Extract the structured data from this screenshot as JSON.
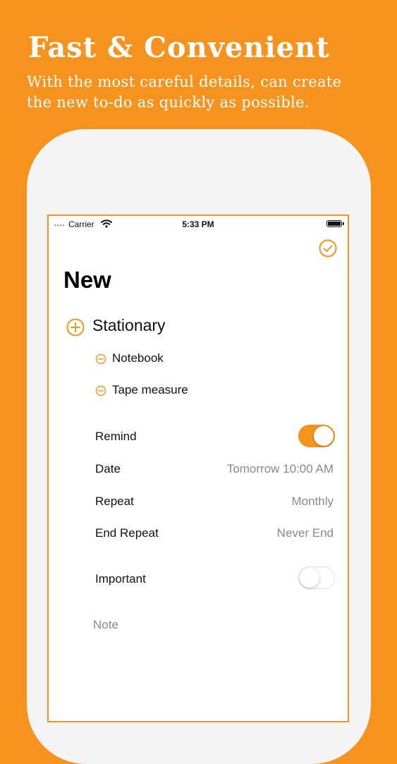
{
  "promo": {
    "headline": "Fast & Convenient",
    "subtitle_line1": "With the most careful details, can create",
    "subtitle_line2": "the new to-do as quickly as possible."
  },
  "status_bar": {
    "signal": "••••",
    "carrier": "Carrier",
    "time": "5:33 PM",
    "battery": "battery-full-icon",
    "wifi": "wifi-icon"
  },
  "header": {
    "title": "New",
    "done_icon": "checkmark-circle-icon"
  },
  "group": {
    "name": "Stationary",
    "add_icon": "plus-circle-icon",
    "items": [
      {
        "label": "Notebook",
        "icon": "minus-circle-icon"
      },
      {
        "label": "Tape measure",
        "icon": "minus-circle-icon"
      }
    ]
  },
  "settings": {
    "remind": {
      "label": "Remind",
      "enabled": true
    },
    "date": {
      "label": "Date",
      "value": "Tomorrow 10:00 AM"
    },
    "repeat": {
      "label": "Repeat",
      "value": "Monthly"
    },
    "end_repeat": {
      "label": "End Repeat",
      "value": "Never End"
    },
    "important": {
      "label": "Important",
      "enabled": false
    }
  },
  "note": {
    "placeholder": "Note"
  },
  "colors": {
    "accent": "#F6931E",
    "background": "#F6931E",
    "secondary_text": "#8a8a8e"
  }
}
